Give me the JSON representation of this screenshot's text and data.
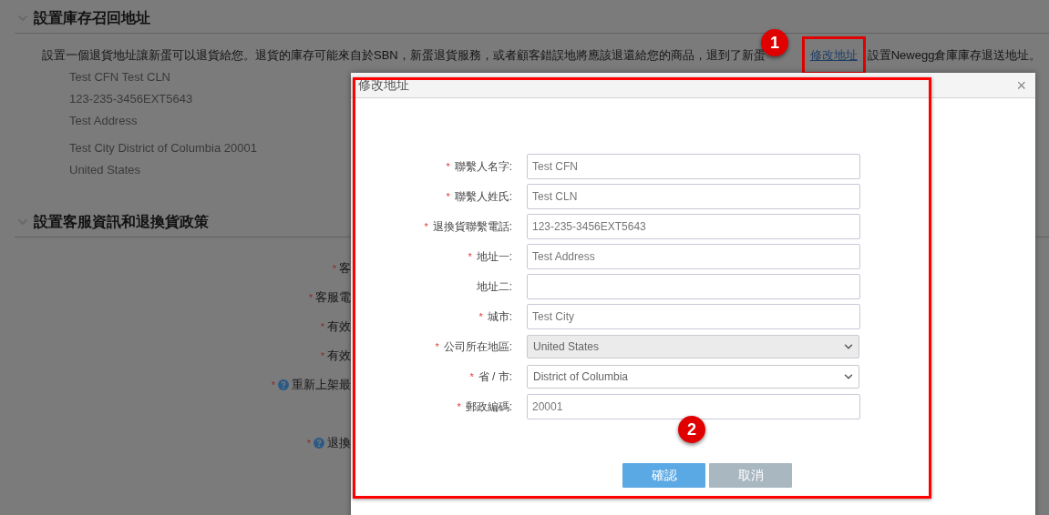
{
  "sections": [
    {
      "title": "設置庫存召回地址",
      "expanded": true
    },
    {
      "title": "設置客服資訊和退換貨政策",
      "expanded": true
    }
  ],
  "intro": {
    "text": "設置一個退貨地址讓新蛋可以退貨給您。退貨的庫存可能來自於SBN，新蛋退貨服務，或者顧客錯誤地將應該退還給您的商品，退到了新蛋",
    "link": "修改地址",
    "after": "設置Newegg倉庫庫存退送地址。"
  },
  "address_lines": [
    "Test CFN Test CLN",
    "123-235-3456EXT5643",
    "Test Address",
    "Test City District of Columbia 20001",
    "United States"
  ],
  "required_mark": "*",
  "policy_labels": [
    {
      "text": "客",
      "help": false
    },
    {
      "text": "客服電",
      "help": false
    },
    {
      "text": "有效",
      "help": false
    },
    {
      "text": "有效",
      "help": false
    },
    {
      "text": "重新上架最",
      "help": true
    },
    {
      "text": "退換",
      "help": true
    }
  ],
  "dialog": {
    "title": "修改地址",
    "close": "×",
    "fields": [
      {
        "label": "聯繫人名字:",
        "required": true,
        "kind": "text",
        "value": "Test CFN",
        "disabled": false
      },
      {
        "label": "聯繫人姓氏:",
        "required": true,
        "kind": "text",
        "value": "Test CLN",
        "disabled": false
      },
      {
        "label": "退換貨聯繫電話:",
        "required": true,
        "kind": "text",
        "value": "123-235-3456EXT5643",
        "disabled": false
      },
      {
        "label": "地址一:",
        "required": true,
        "kind": "text",
        "value": "Test Address",
        "disabled": false
      },
      {
        "label": "地址二:",
        "required": false,
        "kind": "text",
        "disabled": false
      },
      {
        "label": "城市:",
        "required": true,
        "kind": "text",
        "value": "Test City",
        "disabled": false
      },
      {
        "label": "公司所在地區:",
        "required": true,
        "kind": "select",
        "value": "United States",
        "disabled": true
      },
      {
        "label": "省 / 市:",
        "required": true,
        "kind": "select",
        "value": "District of Columbia",
        "disabled": false
      },
      {
        "label": "郵政編碼:",
        "required": true,
        "kind": "text",
        "value": "20001",
        "disabled": false
      }
    ],
    "buttons": [
      {
        "label": "確認",
        "kind": "primary"
      },
      {
        "label": "取消",
        "kind": "secondary"
      }
    ]
  },
  "annotations": [
    {
      "number": "1"
    },
    {
      "number": "2"
    }
  ]
}
